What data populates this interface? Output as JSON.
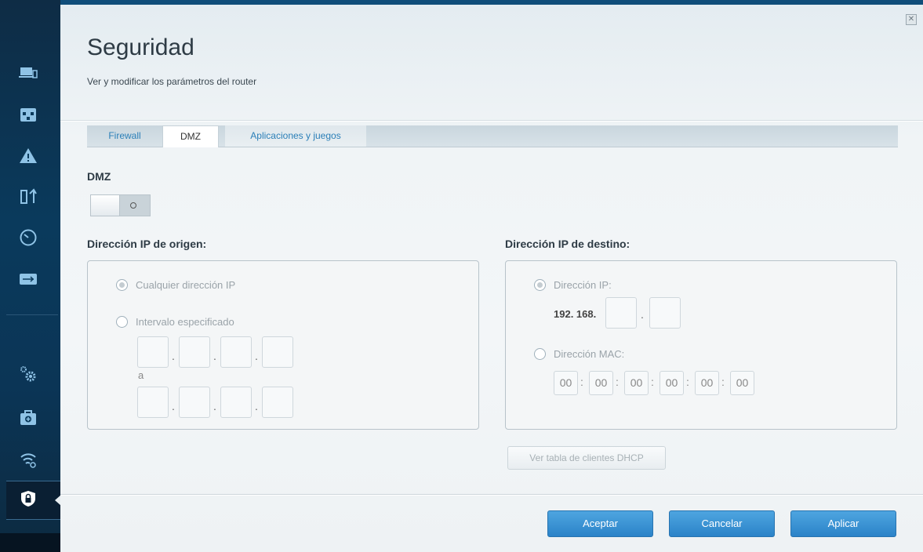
{
  "page": {
    "title": "Seguridad",
    "subtitle": "Ver y modificar los parámetros del router",
    "close_glyph": "✕"
  },
  "sidebar": {
    "items": [
      {
        "name": "devices-icon"
      },
      {
        "name": "parental-controls-icon"
      },
      {
        "name": "alert-icon"
      },
      {
        "name": "media-priority-icon"
      },
      {
        "name": "speed-test-icon"
      },
      {
        "name": "external-storage-icon"
      },
      {
        "name": "settings-icon"
      },
      {
        "name": "troubleshooting-icon"
      },
      {
        "name": "wireless-icon"
      },
      {
        "name": "security-icon",
        "selected": true
      }
    ]
  },
  "tabs": [
    {
      "label": "Firewall",
      "active": false
    },
    {
      "label": "DMZ",
      "active": true
    },
    {
      "label": "Aplicaciones y juegos",
      "active": false
    }
  ],
  "dmz": {
    "label": "DMZ",
    "toggle_state": "off"
  },
  "source": {
    "label": "Dirección IP de origen:",
    "option_any": "Cualquier dirección IP",
    "option_range": "Intervalo especificado",
    "to_label": "a",
    "selected": "any"
  },
  "destination": {
    "label": "Dirección IP de destino:",
    "option_ip": "Dirección IP:",
    "ip_prefix": "192. 168.",
    "option_mac": "Dirección MAC:",
    "mac_values": [
      "00",
      "00",
      "00",
      "00",
      "00",
      "00"
    ],
    "selected": "ip"
  },
  "dhcp_button": "Ver tabla de clientes DHCP",
  "footer": {
    "accept": "Aceptar",
    "cancel": "Cancelar",
    "apply": "Aplicar"
  },
  "colors": {
    "accent": "#2b83c8",
    "sidebar": "#0a3a5c"
  }
}
